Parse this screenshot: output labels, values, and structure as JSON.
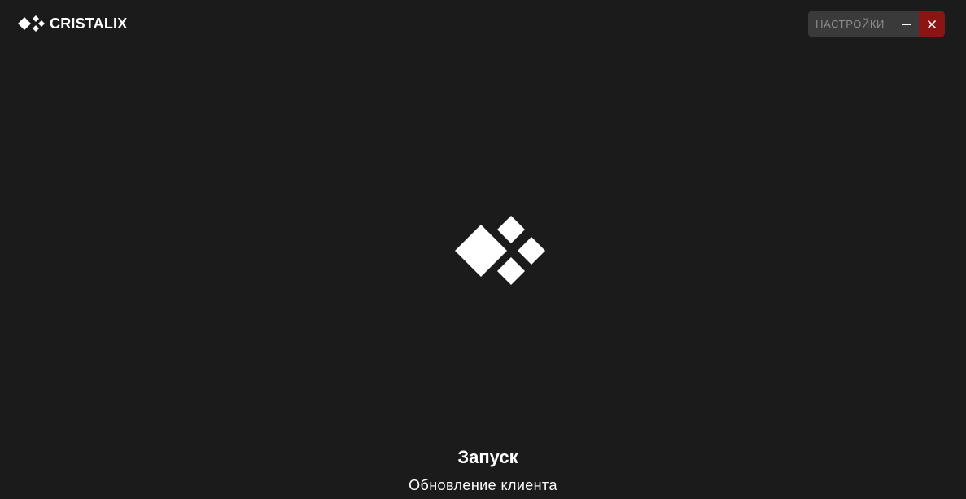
{
  "app": {
    "brand_name": "CRISTALIX",
    "logo_icon": "diamond-cluster-icon"
  },
  "window_controls": {
    "settings_label": "НАСТРОЙКИ",
    "minimize_icon": "minimize-icon",
    "close_icon": "close-icon",
    "close_color": "#8b1515"
  },
  "loading": {
    "logo_icon": "diamond-cluster-icon",
    "title": "Запуск",
    "subtitle": "Обновление клиента"
  },
  "colors": {
    "background": "#1b1b1b",
    "controls_background": "#3a3a3a",
    "settings_text": "#8d8d8d",
    "foreground": "#ffffff"
  }
}
